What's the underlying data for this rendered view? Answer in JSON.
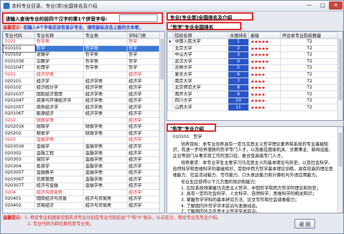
{
  "window": {
    "title": "本科专业目录、专业(类)全国排名及介绍",
    "min": "—",
    "max": "□",
    "close": "✕"
  },
  "query": {
    "label": "请输入查询专业的前四个汉字的第1个拼音字母:",
    "value": ""
  },
  "hint": {
    "prefix": "温馨提示:",
    "text": "如输入4个字母后没有显示专业，请用鼠标点击上面的文本框，"
  },
  "left_table": {
    "headers": [
      "专业代码",
      "专业名称",
      "专业类",
      "学科门类"
    ],
    "rows": [
      {
        "code": "0101",
        "name": "哲学类",
        "cls": "",
        "door": "哲学",
        "red": true
      },
      {
        "code": "010101",
        "name": "哲学",
        "cls": "哲学类",
        "door": "哲学",
        "sel": true
      },
      {
        "code": "010102",
        "name": "逻辑学",
        "cls": "哲学类",
        "door": "哲学"
      },
      {
        "code": "010103K",
        "name": "宗教学",
        "cls": "哲学类",
        "door": "哲学"
      },
      {
        "code": "010104T",
        "name": "伦理学",
        "cls": "哲学类",
        "door": "哲学"
      },
      {
        "code": "0201",
        "name": "经济学类",
        "cls": "",
        "door": "经济学",
        "red": true
      },
      {
        "code": "020101",
        "name": "经济学",
        "cls": "经济学类",
        "door": "经济学"
      },
      {
        "code": "020102",
        "name": "经济统计学",
        "cls": "经济学类",
        "door": "经济学"
      },
      {
        "code": "020103T",
        "name": "国民经济管理",
        "cls": "经济学类",
        "door": "经济学"
      },
      {
        "code": "020104T",
        "name": "资源与环境经济学",
        "cls": "经济学类",
        "door": "经济学"
      },
      {
        "code": "020105T",
        "name": "商务经济学",
        "cls": "经济学类",
        "door": "经济学"
      },
      {
        "code": "020106T",
        "name": "能源经济",
        "cls": "经济学类",
        "door": "经济学"
      },
      {
        "code": "0202",
        "name": "财政学类",
        "cls": "",
        "door": "经济学",
        "red": true
      },
      {
        "code": "020201K",
        "name": "财政学",
        "cls": "财政学类",
        "door": "经济学"
      },
      {
        "code": "020202",
        "name": "税收学",
        "cls": "财政学类",
        "door": "经济学"
      },
      {
        "code": "0203",
        "name": "金融学类",
        "cls": "",
        "door": "经济学",
        "red": true
      },
      {
        "code": "020301K",
        "name": "金融学",
        "cls": "金融学类",
        "door": "经济学"
      },
      {
        "code": "020302",
        "name": "金融工程",
        "cls": "金融学类",
        "door": "经济学"
      },
      {
        "code": "020303",
        "name": "保险学",
        "cls": "金融学类",
        "door": "经济学"
      },
      {
        "code": "020304",
        "name": "投资学",
        "cls": "金融学类",
        "door": "经济学"
      },
      {
        "code": "020305T",
        "name": "金融数学",
        "cls": "金融学类",
        "door": "经济学"
      },
      {
        "code": "020306T",
        "name": "信用管理",
        "cls": "金融学类",
        "door": "经济学"
      },
      {
        "code": "020307T",
        "name": "经济与金融",
        "cls": "金融学类",
        "door": "经济学"
      },
      {
        "code": "0204",
        "name": "经济与贸易类",
        "cls": "",
        "door": "经济学",
        "red": true
      },
      {
        "code": "020401",
        "name": "国际经济与贸易",
        "cls": "经济与贸易类",
        "door": "经济学"
      },
      {
        "code": "020402",
        "name": "贸易经济",
        "cls": "经济与贸易类",
        "door": "经济学"
      }
    ]
  },
  "rank_box": {
    "title1": "专业(专业类)全国排名及介绍",
    "title2": "\"哲学\"专业全国排名"
  },
  "rank_table": {
    "headers": [
      "院校名称",
      "全国排名",
      "星级",
      "开设本专业院校数量"
    ],
    "rows": [
      {
        "school": "中国人民大学",
        "rank": "1",
        "stars": "★★★★★",
        "count": "T2"
      },
      {
        "school": "北京大学",
        "rank": "2",
        "stars": "★★★★★",
        "count": "T2"
      },
      {
        "school": "中山大学",
        "rank": "3",
        "stars": "★★★★★",
        "count": "T2"
      },
      {
        "school": "武汉大学",
        "rank": "4",
        "stars": "★★★★★",
        "count": "T2"
      },
      {
        "school": "吉林大学",
        "rank": "5",
        "stars": "★★★★",
        "count": "T2"
      },
      {
        "school": "复旦大学",
        "rank": "6",
        "stars": "★★★★",
        "count": "T2"
      },
      {
        "school": "南京大学",
        "rank": "7",
        "stars": "★★★★",
        "count": "T2"
      },
      {
        "school": "北京师范大学",
        "rank": "8",
        "stars": "★★★★",
        "count": "T2"
      },
      {
        "school": "南开大学",
        "rank": "9",
        "stars": "★★★★",
        "count": "T2"
      },
      {
        "school": "四川大学",
        "rank": "10",
        "stars": "★★★★",
        "count": "T2"
      },
      {
        "school": "山西大学",
        "rank": "11",
        "stars": "★★★★",
        "count": "T2"
      }
    ]
  },
  "intro_title": "\"哲学\"专业介绍",
  "intro": {
    "code": "010101",
    "name": "哲学",
    "p1": "培养目标：本专业培养具有一定马克思主义哲学理论素养和系统的专业基础知识，有进一步培养潜质的哲学专门人才，以及能在国家机关、文教事业、新闻出版、企业等部门从事实际工作的宽口径、复合型高级专门人才。",
    "p2": "培养要求：本专业学生主要学习马克思主义的基本理论与历史，以及社会科学、自然科学和思维科学的基础知识，受到中西方哲学基本理论训练，具有较高的理论思维能力、社会活动能力、写作能力、口头表达能力和计算机与外语应用能力。",
    "p3": "毕业生应获得以下几方面的知识和能力：",
    "items": [
      "1. 比较系统地掌握马克思主义哲学、中国哲学和西方哲学的理论和历史；",
      "2. 具有一定的社会科学、人文科学、自然科学、思维科学的相关知识；",
      "3. 掌握哲学学科的基本研究方法、论文写作和社会调查能力；",
      "4. 了解国内外哲学学术前沿与发展动态。",
      "7. 了解国内外马克思主义哲学学术前沿。"
    ]
  },
  "footer": {
    "label": "温馨提示:",
    "line1": "1. 特设专业和国家控制布点专业分别在专业代码后加\"T\"和\"K\"表示，以示区分，特设专业无专业介绍。",
    "line2": "2. 专业代码为四位数的是专业类。"
  },
  "back_label": "返 回"
}
